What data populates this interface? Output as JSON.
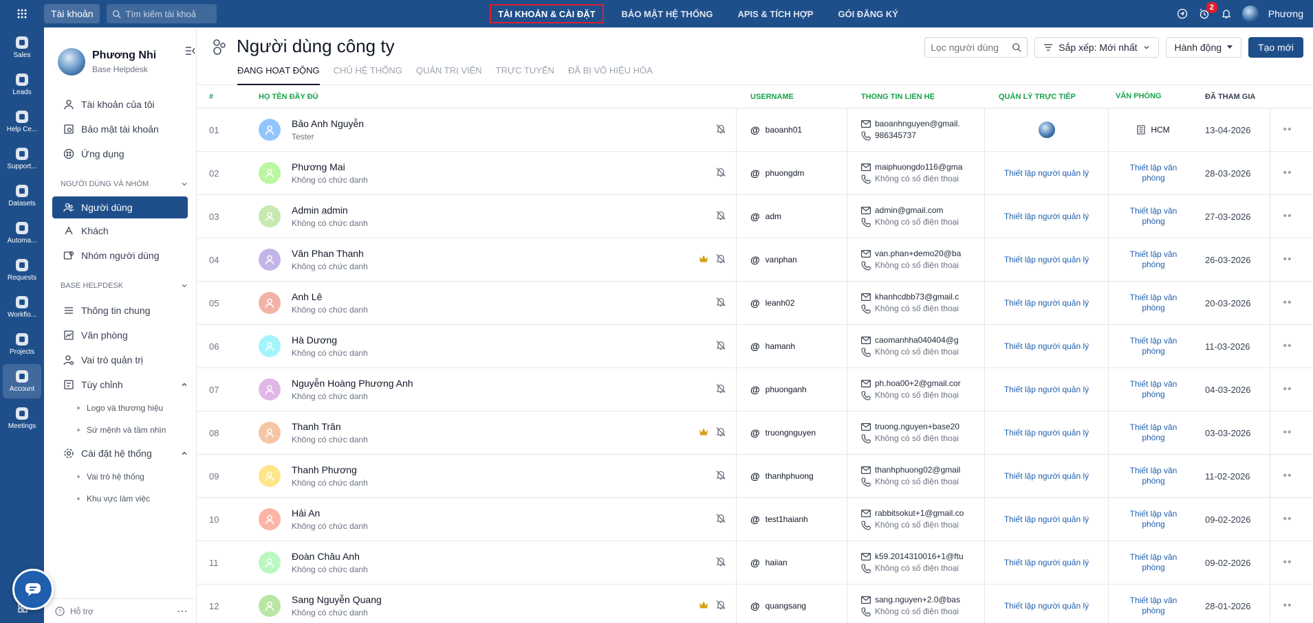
{
  "topbar": {
    "account_chip": "Tài khoản",
    "search_placeholder": "Tìm kiếm tài khoả",
    "tabs": [
      {
        "label": "TÀI KHOẢN & CÀI ĐẶT"
      },
      {
        "label": "BẢO MẬT HỆ THỐNG"
      },
      {
        "label": "APIS & TÍCH HỢP"
      },
      {
        "label": "GÓI ĐĂNG KÝ"
      }
    ],
    "notification_count": "2",
    "user_name": "Phương"
  },
  "rail": {
    "items": [
      {
        "label": "Sales"
      },
      {
        "label": "Leads"
      },
      {
        "label": "Help Ce..."
      },
      {
        "label": "Support..."
      },
      {
        "label": "Datasets"
      },
      {
        "label": "Automa..."
      },
      {
        "label": "Requests"
      },
      {
        "label": "Workflo..."
      },
      {
        "label": "Projects"
      },
      {
        "label": "Account"
      },
      {
        "label": "Meetings"
      }
    ]
  },
  "sidebar": {
    "profile_name": "Phương Nhi",
    "profile_sub": "Base Helpdesk",
    "top_items": [
      {
        "label": "Tài khoản của tôi"
      },
      {
        "label": "Bảo mật tài khoản"
      },
      {
        "label": "Ứng dụng"
      }
    ],
    "section1": "NGƯỜI DÙNG VÀ NHÓM",
    "section1_items": [
      {
        "label": "Người dùng"
      },
      {
        "label": "Khách"
      },
      {
        "label": "Nhóm người dùng"
      }
    ],
    "section2": "BASE HELPDESK",
    "section2_items": [
      {
        "label": "Thông tin chung"
      },
      {
        "label": "Văn phòng"
      },
      {
        "label": "Vai trò quản trị"
      }
    ],
    "group_custom": "Tùy chỉnh",
    "group_custom_items": [
      {
        "label": "Logo và thương hiệu"
      },
      {
        "label": "Sứ mệnh và tầm nhìn"
      }
    ],
    "group_system": "Cài đặt hệ thống",
    "group_system_items": [
      {
        "label": "Vai trò hệ thống"
      },
      {
        "label": "Khu vực làm việc"
      }
    ],
    "footer_label": "Hỗ trợ"
  },
  "main": {
    "title": "Người dùng công ty",
    "subtabs": [
      {
        "label": "ĐANG HOẠT ĐỘNG"
      },
      {
        "label": "CHỦ HỆ THỐNG"
      },
      {
        "label": "QUẢN TRỊ VIÊN"
      },
      {
        "label": "TRỰC TUYẾN"
      },
      {
        "label": "ĐÃ BỊ VÔ HIỆU HÓA"
      }
    ],
    "filter_placeholder": "Lọc người dùng",
    "sort_label": "Sắp xếp: Mới nhất",
    "action_label": "Hành động",
    "create_label": "Tạo mới"
  },
  "table": {
    "headers": {
      "num": "#",
      "name": "HỌ TÊN ĐẦY ĐỦ",
      "username": "USERNAME",
      "contact": "THÔNG TIN LIÊN HỆ",
      "manager": "QUẢN LÝ TRỰC TIẾP",
      "office": "VĂN PHÒNG",
      "joined": "ĐÃ THAM GIA"
    },
    "rows": [
      {
        "num": "01",
        "name": "Bảo Anh Nguyễn",
        "role": "Tester",
        "username": "baoanh01",
        "email": "baoanhnguyen@gmail.",
        "phone": "986345737",
        "manager": "",
        "office": "HCM",
        "joined": "13-04-2026",
        "avatar_color": "#93c5fd",
        "crown": false
      },
      {
        "num": "02",
        "name": "Phương Mai",
        "role": "Không có chức danh",
        "username": "phuongdm",
        "email": "maiphuongdo116@gma",
        "phone": "Không có số điện thoại",
        "manager": "Thiết lập người quản lý",
        "office": "Thiết lập văn phòng",
        "joined": "28-03-2026",
        "avatar_color": "#bbf7a0",
        "crown": false
      },
      {
        "num": "03",
        "name": "Admin admin",
        "role": "Không có chức danh",
        "username": "adm",
        "email": "admin@gmail.com",
        "phone": "Không có số điện thoại",
        "manager": "Thiết lập người quản lý",
        "office": "Thiết lập văn phòng",
        "joined": "27-03-2026",
        "avatar_color": "#c7e9b0",
        "crown": false
      },
      {
        "num": "04",
        "name": "Vân Phan Thanh",
        "role": "Không có chức danh",
        "username": "vanphan",
        "email": "van.phan+demo20@ba",
        "phone": "Không có số điện thoại",
        "manager": "Thiết lập người quản lý",
        "office": "Thiết lập văn phòng",
        "joined": "26-03-2026",
        "avatar_color": "#c4b5e8",
        "crown": true
      },
      {
        "num": "05",
        "name": "Anh Lê",
        "role": "Không có chức danh",
        "username": "leanh02",
        "email": "khanhcdbb73@gmail.c",
        "phone": "Không có số điện thoại",
        "manager": "Thiết lập người quản lý",
        "office": "Thiết lập văn phòng",
        "joined": "20-03-2026",
        "avatar_color": "#f1b3a5",
        "crown": false
      },
      {
        "num": "06",
        "name": "Hà Dương",
        "role": "Không có chức danh",
        "username": "hamanh",
        "email": "caomanhha040404@g",
        "phone": "Không có số điện thoại",
        "manager": "Thiết lập người quản lý",
        "office": "Thiết lập văn phòng",
        "joined": "11-03-2026",
        "avatar_color": "#a5f3fc",
        "crown": false
      },
      {
        "num": "07",
        "name": "Nguyễn Hoàng Phương Anh",
        "role": "Không có chức danh",
        "username": "phuonganh",
        "email": "ph.hoa00+2@gmail.cor",
        "phone": "Không có số điện thoại",
        "manager": "Thiết lập người quản lý",
        "office": "Thiết lập văn phòng",
        "joined": "04-03-2026",
        "avatar_color": "#e0b8e8",
        "crown": false
      },
      {
        "num": "08",
        "name": "Thanh Trân",
        "role": "Không có chức danh",
        "username": "truongnguyen",
        "email": "truong.nguyen+base20",
        "phone": "Không có số điện thoại",
        "manager": "Thiết lập người quản lý",
        "office": "Thiết lập văn phòng",
        "joined": "03-03-2026",
        "avatar_color": "#f5c6a5",
        "crown": true
      },
      {
        "num": "09",
        "name": "Thanh Phương",
        "role": "Không có chức danh",
        "username": "thanhphuong",
        "email": "thanhphuong02@gmail",
        "phone": "Không có số điện thoại",
        "manager": "Thiết lập người quản lý",
        "office": "Thiết lập văn phòng",
        "joined": "11-02-2026",
        "avatar_color": "#fde68a",
        "crown": false
      },
      {
        "num": "10",
        "name": "Hải An",
        "role": "Không có chức danh",
        "username": "test1haianh",
        "email": "rabbitsokut+1@gmail.co",
        "phone": "Không có số điện thoại",
        "manager": "Thiết lập người quản lý",
        "office": "Thiết lập văn phòng",
        "joined": "09-02-2026",
        "avatar_color": "#fbb4a5",
        "crown": false
      },
      {
        "num": "11",
        "name": "Đoàn Châu Anh",
        "role": "Không có chức danh",
        "username": "haiian",
        "email": "k59.2014310016+1@ftu",
        "phone": "Không có số điện thoại",
        "manager": "Thiết lập người quản lý",
        "office": "Thiết lập văn phòng",
        "joined": "09-02-2026",
        "avatar_color": "#bbf7c0",
        "crown": false
      },
      {
        "num": "12",
        "name": "Sang Nguyễn Quang",
        "role": "Không có chức danh",
        "username": "quangsang",
        "email": "sang.nguyen+2.0@bas",
        "phone": "Không có số điện thoại",
        "manager": "Thiết lập người quản lý",
        "office": "Thiết lập văn phòng",
        "joined": "28-01-2026",
        "avatar_color": "#b9e6a5",
        "crown": true
      }
    ]
  },
  "colors": {
    "brand": "#1f4f8b",
    "header_green": "#16a34a",
    "link_blue": "#1f5fae",
    "highlight_red": "#e11d2f",
    "crown": "#d4a017"
  }
}
